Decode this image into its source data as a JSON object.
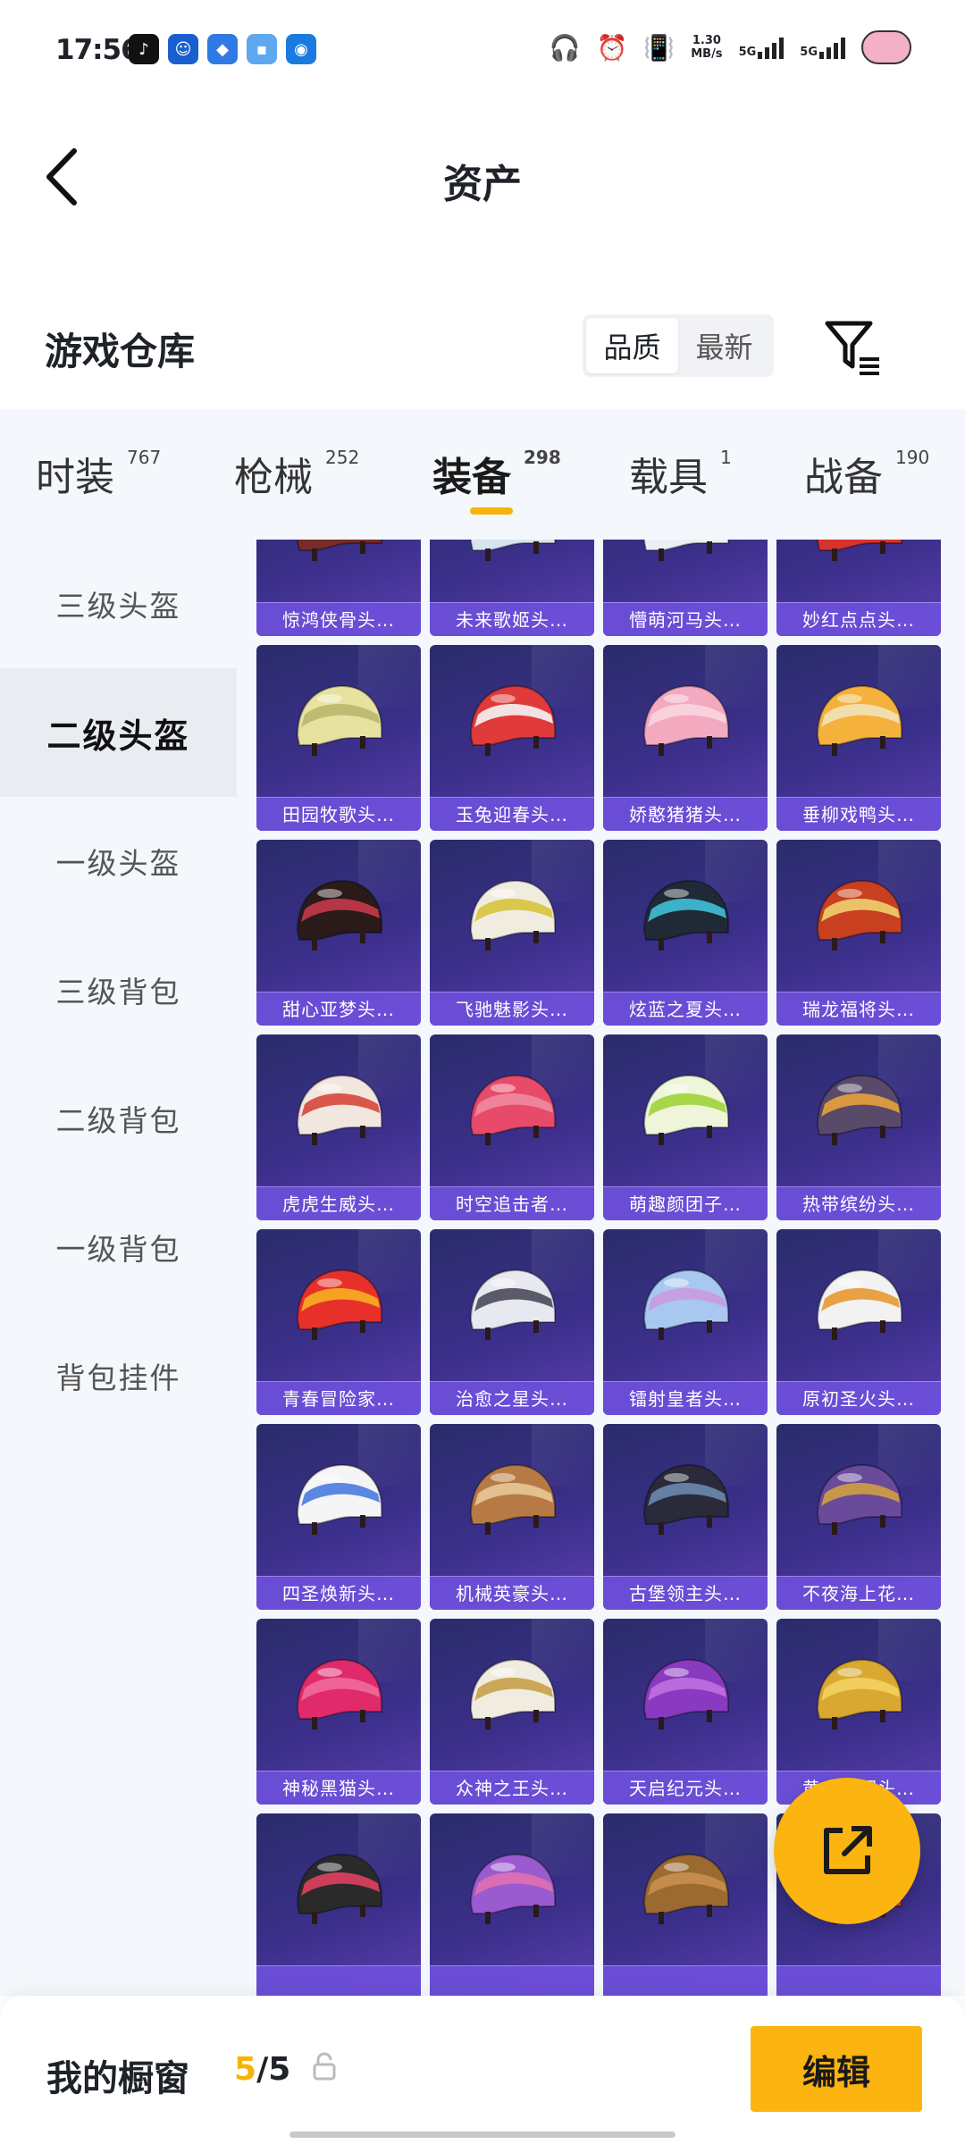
{
  "status": {
    "time": "17:56",
    "net_speed_value": "1.30",
    "net_speed_unit": "MB/s",
    "sim1": "5G",
    "sim2": "5G"
  },
  "header": {
    "title": "资产"
  },
  "section": {
    "title": "游戏仓库",
    "sort_quality": "品质",
    "sort_newest": "最新"
  },
  "tabs": [
    {
      "label": "时装",
      "count": "767"
    },
    {
      "label": "枪械",
      "count": "252"
    },
    {
      "label": "装备",
      "count": "298"
    },
    {
      "label": "载具",
      "count": "1"
    },
    {
      "label": "战备",
      "count": "190"
    }
  ],
  "sidebar": [
    {
      "label": "三级头盔"
    },
    {
      "label": "二级头盔"
    },
    {
      "label": "一级头盔"
    },
    {
      "label": "三级背包"
    },
    {
      "label": "二级背包"
    },
    {
      "label": "一级背包"
    },
    {
      "label": "背包挂件"
    }
  ],
  "items": [
    {
      "name": "惊鸿侠骨头…",
      "c1": "#7a2a2a",
      "c2": "#d9c9b0"
    },
    {
      "name": "未来歌姬头…",
      "c1": "#d6e4f0",
      "c2": "#8fb2d6"
    },
    {
      "name": "懵萌河马头…",
      "c1": "#e8f0f5",
      "c2": "#9fd4e0"
    },
    {
      "name": "妙红点点头…",
      "c1": "#d8322f",
      "c2": "#f2e0c0"
    },
    {
      "name": "田园牧歌头…",
      "c1": "#e8e2a0",
      "c2": "#b9b86a"
    },
    {
      "name": "玉兔迎春头…",
      "c1": "#e03a3a",
      "c2": "#f5f5f5"
    },
    {
      "name": "娇憨猪猪头…",
      "c1": "#f3a9c0",
      "c2": "#f9d5df"
    },
    {
      "name": "垂柳戏鸭头…",
      "c1": "#f4b23c",
      "c2": "#f2e2b8"
    },
    {
      "name": "甜心亚梦头…",
      "c1": "#2a1a1a",
      "c2": "#c73a4a"
    },
    {
      "name": "飞驰魅影头…",
      "c1": "#f0ede0",
      "c2": "#d8c23c"
    },
    {
      "name": "炫蓝之夏头…",
      "c1": "#1f2a36",
      "c2": "#3fc0d8"
    },
    {
      "name": "瑞龙福将头…",
      "c1": "#c8401f",
      "c2": "#f0d070"
    },
    {
      "name": "虎虎生威头…",
      "c1": "#f2e7de",
      "c2": "#d8463a"
    },
    {
      "name": "时空追击者…",
      "c1": "#e84a6a",
      "c2": "#f08aa0"
    },
    {
      "name": "萌趣颜团子…",
      "c1": "#eef5d8",
      "c2": "#9fd33a"
    },
    {
      "name": "热带缤纷头…",
      "c1": "#5a4a6a",
      "c2": "#e8a23c"
    },
    {
      "name": "青春冒险家…",
      "c1": "#e8302a",
      "c2": "#f6b020"
    },
    {
      "name": "治愈之星头…",
      "c1": "#e8e8f0",
      "c2": "#4a4a5a"
    },
    {
      "name": "镭射皇者头…",
      "c1": "#a8c8f0",
      "c2": "#c89ae0"
    },
    {
      "name": "原初圣火头…",
      "c1": "#f2f2f2",
      "c2": "#e89830"
    },
    {
      "name": "四圣焕新头…",
      "c1": "#f5f5f5",
      "c2": "#4a7ae0"
    },
    {
      "name": "机械英豪头…",
      "c1": "#b87a44",
      "c2": "#e8c898"
    },
    {
      "name": "古堡领主头…",
      "c1": "#2a2a3a",
      "c2": "#6a8ab0"
    },
    {
      "name": "不夜海上花…",
      "c1": "#6a4a9a",
      "c2": "#d0a040"
    },
    {
      "name": "神秘黑猫头…",
      "c1": "#e02a6a",
      "c2": "#f06a9a"
    },
    {
      "name": "众神之王头…",
      "c1": "#f0ece0",
      "c2": "#c8a048"
    },
    {
      "name": "天启纪元头…",
      "c1": "#8a3ac0",
      "c2": "#c070e0"
    },
    {
      "name": "黄金王冠头…",
      "c1": "#d8a830",
      "c2": "#f4d060"
    },
    {
      "name": "",
      "c1": "#2a2a2a",
      "c2": "#e04060"
    },
    {
      "name": "",
      "c1": "#9a5ad0",
      "c2": "#e070b0"
    },
    {
      "name": "",
      "c1": "#9a6a30",
      "c2": "#c89050"
    },
    {
      "name": "",
      "c1": "#c8402a",
      "c2": "#e8a050"
    }
  ],
  "bottom": {
    "label": "我的橱窗",
    "current": "5",
    "total": "/5",
    "edit": "编辑"
  },
  "colors": {
    "accent": "#fbb410",
    "card_bg": "#3b2f8a",
    "card_caption": "#6e50dc"
  }
}
